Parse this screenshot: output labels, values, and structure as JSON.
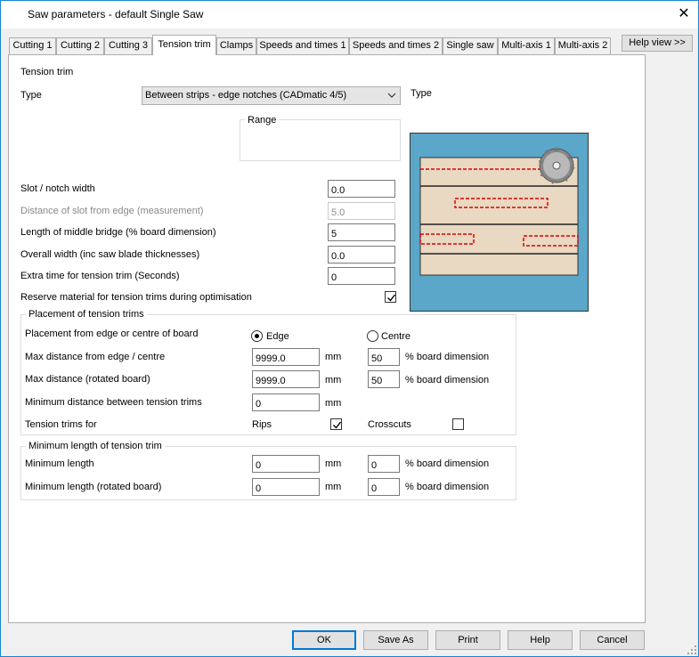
{
  "window": {
    "title": "Saw parameters - default Single Saw"
  },
  "tabs": [
    {
      "label": "Cutting 1"
    },
    {
      "label": "Cutting 2"
    },
    {
      "label": "Cutting 3"
    },
    {
      "label": "Tension trim"
    },
    {
      "label": "Clamps"
    },
    {
      "label": "Speeds and times 1"
    },
    {
      "label": "Speeds and times 2"
    },
    {
      "label": "Single saw"
    },
    {
      "label": "Multi-axis 1"
    },
    {
      "label": "Multi-axis 2"
    }
  ],
  "help_view_label": "Help view >>",
  "section_title": "Tension trim",
  "type": {
    "label": "Type",
    "value": "Between strips - edge notches (CADmatic 4/5)",
    "side_label": "Type"
  },
  "range_label": "Range",
  "fields": {
    "slot_width": {
      "label": "Slot / notch width",
      "value": "0.0"
    },
    "slot_distance": {
      "label": "Distance of slot from edge (measurement)",
      "value": "5.0"
    },
    "middle_bridge": {
      "label": "Length of middle bridge (% board dimension)",
      "value": "5"
    },
    "overall_width": {
      "label": "Overall width (inc saw blade thicknesses)",
      "value": "0.0"
    },
    "extra_time": {
      "label": "Extra time for tension trim (Seconds)",
      "value": "0"
    },
    "reserve_material": {
      "label": "Reserve material for tension trims during optimisation"
    }
  },
  "placement": {
    "title": "Placement of tension trims",
    "from_label": "Placement from edge or centre of board",
    "edge_label": "Edge",
    "centre_label": "Centre",
    "max_distance": {
      "label": "Max distance from edge / centre",
      "value": "9999.0",
      "unit": "mm",
      "percent": "50",
      "percent_label": "% board dimension"
    },
    "max_distance_rotated": {
      "label": "Max distance (rotated board)",
      "value": "9999.0",
      "unit": "mm",
      "percent": "50",
      "percent_label": "% board dimension"
    },
    "min_between": {
      "label": "Minimum distance between tension trims",
      "value": "0",
      "unit": "mm"
    },
    "trims_for_label": "Tension trims for",
    "rips_label": "Rips",
    "crosscuts_label": "Crosscuts"
  },
  "min_length": {
    "title": "Minimum length of tension trim",
    "length": {
      "label": "Minimum length",
      "value": "0",
      "unit": "mm",
      "percent": "0",
      "percent_label": "% board dimension"
    },
    "length_rotated": {
      "label": "Minimum length (rotated board)",
      "value": "0",
      "unit": "mm",
      "percent": "0",
      "percent_label": "% board dimension"
    }
  },
  "buttons": {
    "ok": "OK",
    "save_as": "Save As",
    "print": "Print",
    "help": "Help",
    "cancel": "Cancel"
  },
  "colors": {
    "preview_bg": "#5ba7c9",
    "board": "#e9d8c2",
    "trim": "#e00000",
    "accent": "#0078d7"
  }
}
